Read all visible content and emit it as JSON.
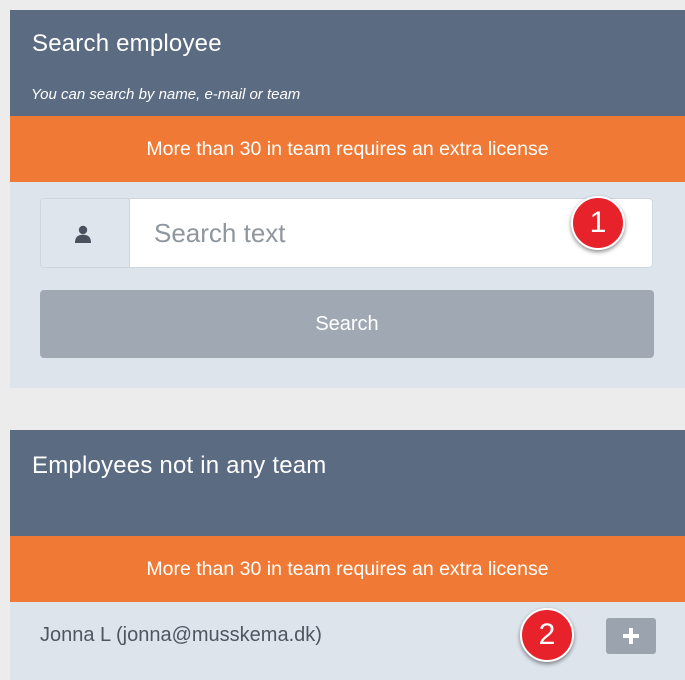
{
  "search_panel": {
    "title": "Search employee",
    "subtitle": "You can search by name, e-mail or team",
    "license_notice": "More than 30 in team requires an extra license",
    "search_input": {
      "placeholder": "Search text",
      "value": "",
      "icon": "user-icon"
    },
    "search_button_label": "Search"
  },
  "employees_panel": {
    "title": "Employees not in any team",
    "license_notice": "More than 30 in team requires an extra license",
    "employees": [
      {
        "label": "Jonna L (jonna@musskema.dk)",
        "action_icon": "plus-icon"
      }
    ]
  },
  "markers": [
    "1",
    "2"
  ],
  "colors": {
    "header_bg": "#5b6b82",
    "banner_bg": "#f07a35",
    "panel_bg": "#dde4ec",
    "button_bg": "#a0a8b4",
    "marker_bg": "#e8222b"
  }
}
